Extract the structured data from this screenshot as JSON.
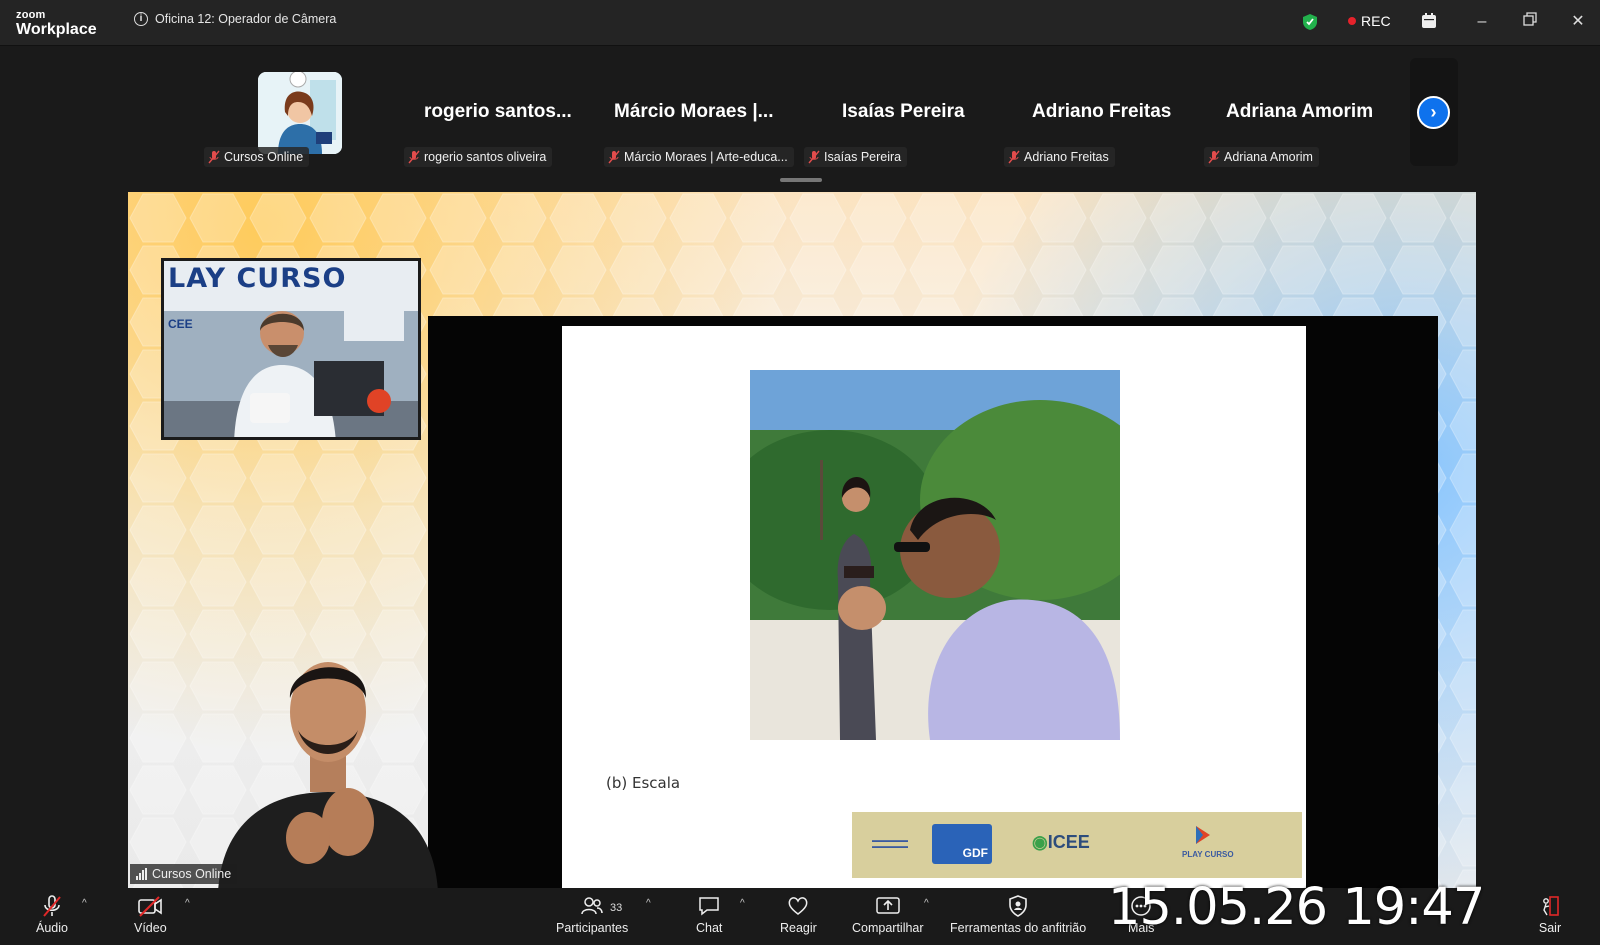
{
  "app": {
    "logo_small": "zoom",
    "logo_big": "Workplace"
  },
  "meeting": {
    "title": "Oficina 12: Operador de Câmera"
  },
  "status": {
    "rec_label": "REC",
    "rec_color": "#e5222b",
    "shield_color": "#22b14c"
  },
  "participants_strip": {
    "big_names": [
      "rogerio  santos...",
      "Márcio  Moraes |...",
      "Isaías Pereira",
      "Adriano Freitas",
      "Adriana Amorim"
    ],
    "tags": [
      "Cursos Online",
      "rogerio santos oliveira",
      "Márcio Moraes | Arte-educa...",
      "Isaías Pereira",
      "Adriano Freitas",
      "Adriana Amorim"
    ],
    "next_icon": "chevron-right-icon"
  },
  "stage": {
    "pip_title": "LAY CURSO",
    "pip_sub": "CEE",
    "slide_caption": "(b) Escala",
    "band_gdf": "GDF",
    "band_icee": "ICEE",
    "band_play": "PLAY CURSO",
    "speaker_label": "Cursos Online"
  },
  "toolbar": {
    "audio": "Áudio",
    "video": "Vídeo",
    "participants": "Participantes",
    "participants_count": "33",
    "chat": "Chat",
    "react": "Reagir",
    "share": "Compartilhar",
    "host_tools": "Ferramentas do anfitrião",
    "more": "Mais",
    "leave": "Sair",
    "leave_color": "#e02828"
  },
  "overlay": {
    "timestamp": "15.05.26 19:47"
  }
}
